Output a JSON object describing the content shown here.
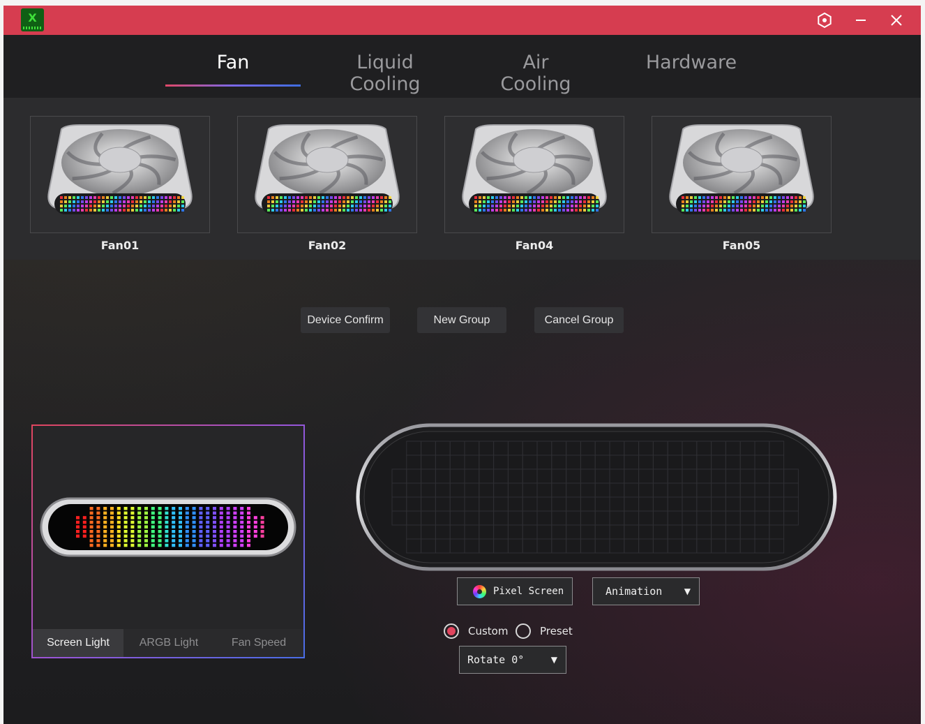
{
  "titlebar": {
    "logo_text": "X",
    "settings_icon": "settings-gear-icon",
    "minimize_icon": "minimize-icon",
    "close_icon": "close-icon",
    "accent_color": "#d63d50"
  },
  "tabs": [
    {
      "label": "Fan",
      "active": true
    },
    {
      "label": "Liquid Cooling",
      "active": false
    },
    {
      "label": "Air Cooling",
      "active": false
    },
    {
      "label": "Hardware",
      "active": false
    }
  ],
  "devices": [
    {
      "label": "Fan01"
    },
    {
      "label": "Fan02"
    },
    {
      "label": "Fan04"
    },
    {
      "label": "Fan05"
    }
  ],
  "actions": {
    "device_confirm": "Device Confirm",
    "new_group": "New Group",
    "cancel_group": "Cancel Group"
  },
  "preview": {
    "tabs": [
      {
        "label": "Screen Light",
        "active": true
      },
      {
        "label": "ARGB Light",
        "active": false
      },
      {
        "label": "Fan Speed",
        "active": false
      }
    ]
  },
  "controls": {
    "pixel_screen_label": "Pixel Screen",
    "animation_value": "Animation",
    "custom_label": "Custom",
    "preset_label": "Preset",
    "custom_checked": true,
    "rotate_value": "Rotate 0°"
  }
}
